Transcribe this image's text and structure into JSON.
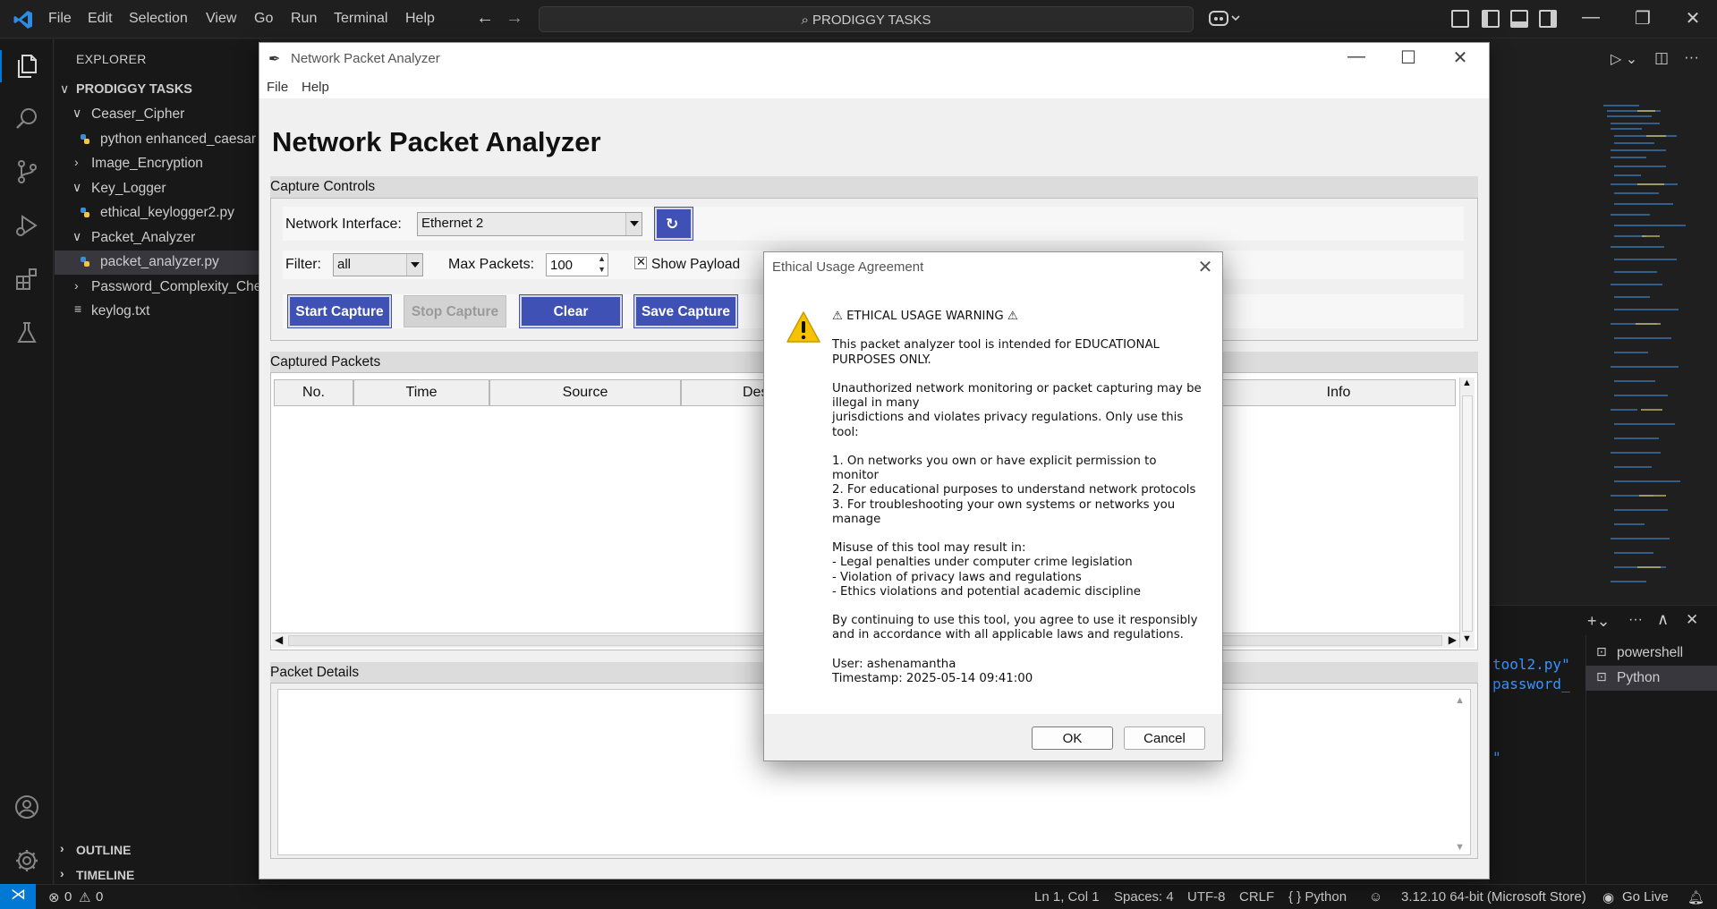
{
  "vscode": {
    "menu": [
      "File",
      "Edit",
      "Selection",
      "View",
      "Go",
      "Run",
      "Terminal",
      "Help"
    ],
    "search_text": "PRODIGGY TASKS",
    "accent": "#0078d4"
  },
  "sidebar": {
    "title": "EXPLORER",
    "root": "PRODIGGY TASKS",
    "items": [
      {
        "label": "Ceaser_Cipher",
        "type": "folder"
      },
      {
        "label": "python enhanced_caesar",
        "type": "py-file"
      },
      {
        "label": "Image_Encryption",
        "type": "folder"
      },
      {
        "label": "Key_Logger",
        "type": "folder"
      },
      {
        "label": "ethical_keylogger2.py",
        "type": "py-file"
      },
      {
        "label": "Packet_Analyzer",
        "type": "folder"
      },
      {
        "label": "packet_analyzer.py",
        "type": "py-file"
      },
      {
        "label": "Password_Complexity_Che",
        "type": "folder"
      },
      {
        "label": "keylog.txt",
        "type": "txt-file"
      }
    ],
    "outline": "OUTLINE",
    "timeline": "TIMELINE"
  },
  "terminal": {
    "items": [
      "powershell",
      "Python"
    ],
    "snippets": [
      "tool2.py\"",
      "password_",
      "\""
    ]
  },
  "statusbar": {
    "errors": "0",
    "warnings": "0",
    "position": "Ln 1, Col 1",
    "spaces": "Spaces: 4",
    "encoding": "UTF-8",
    "eol": "CRLF",
    "language": "{ } Python",
    "interpreter": "3.12.10 64-bit (Microsoft Store)",
    "golive": "Go Live"
  },
  "app": {
    "window_title": "Network Packet Analyzer",
    "menu": [
      "File",
      "Help"
    ],
    "heading": "Network Packet Analyzer",
    "capture_controls": {
      "group_label": "Capture Controls",
      "interface_label": "Network Interface:",
      "interface_value": "Ethernet 2",
      "filter_label": "Filter:",
      "filter_value": "all",
      "max_label": "Max Packets:",
      "max_value": "100",
      "show_payload": "Show Payload",
      "buttons": {
        "start": "Start Capture",
        "stop": "Stop Capture",
        "clear": "Clear",
        "save": "Save Capture"
      }
    },
    "captured": {
      "group_label": "Captured Packets",
      "columns": [
        "No.",
        "Time",
        "Source",
        "Des",
        "Info"
      ]
    },
    "details": {
      "group_label": "Packet Details"
    },
    "button_color": "#3f51b5"
  },
  "dialog": {
    "title": "Ethical Usage Agreement",
    "message": "⚠ ETHICAL USAGE WARNING ⚠\n\nThis packet analyzer tool is intended for EDUCATIONAL\nPURPOSES ONLY.\n\nUnauthorized network monitoring or packet capturing may be\nillegal in many\njurisdictions and violates privacy regulations. Only use this\ntool:\n\n1. On networks you own or have explicit permission to\nmonitor\n2. For educational purposes to understand network protocols\n3. For troubleshooting your own systems or networks you\nmanage\n\nMisuse of this tool may result in:\n- Legal penalties under computer crime legislation\n- Violation of privacy laws and regulations\n- Ethics violations and potential academic discipline\n\nBy continuing to use this tool, you agree to use it responsibly\nand in accordance with all applicable laws and regulations.\n\nUser: ashenamantha\nTimestamp: 2025-05-14 09:41:00",
    "ok": "OK",
    "cancel": "Cancel",
    "icon": "warning-icon"
  }
}
